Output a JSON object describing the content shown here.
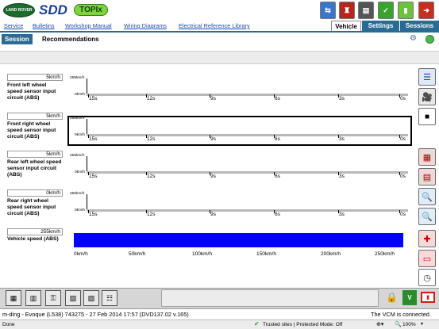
{
  "header": {
    "logo_land_rover": "LAND ROVER",
    "logo_sdd": "SDD",
    "logo_topix": "TOPIx"
  },
  "menu": {
    "links": [
      "Service",
      "Bulletins",
      "Workshop Manual",
      "Wiring Diagrams",
      "Electrical Reference Library"
    ],
    "tabs": [
      "Vehicle",
      "Settings",
      "Sessions"
    ]
  },
  "subtabs": [
    "Session",
    "Recommendations"
  ],
  "signals": [
    {
      "name": "Front left wheel speed sensor input circuit (ABS)",
      "value": "5km/h",
      "y_max": "255km/h",
      "y_min": "0km/h",
      "selected": false
    },
    {
      "name": "Front right wheel speed sensor input circuit (ABS)",
      "value": "5km/h",
      "y_max": "255km/h",
      "y_min": "0km/h",
      "selected": true
    },
    {
      "name": "Rear left wheel speed sensor input circuit (ABS)",
      "value": "5km/h",
      "y_max": "255km/h",
      "y_min": "0km/h",
      "selected": false
    },
    {
      "name": "Rear right wheel speed sensor input circuit (ABS)",
      "value": "0km/h",
      "y_max": "255km/h",
      "y_min": "0km/h",
      "selected": false
    }
  ],
  "time_ticks": [
    "15s",
    "12s",
    "9s",
    "6s",
    "3s",
    "0s"
  ],
  "vehicle_speed": {
    "name": "Vehicle speed (ABS)",
    "value": "255km/h",
    "fraction": 1.0,
    "ticks": [
      "0km/h",
      "50km/h",
      "100km/h",
      "150km/h",
      "200km/h",
      "250km/h"
    ],
    "bar_color": "#0000ff"
  },
  "status": {
    "vehicle_info": "m-ding - Evoque (L538) 743275 - 27 Feb 2014 17:57 (DVD137.02 v.165)",
    "connection": "The VCM is connected.",
    "browser_left": "Done",
    "browser_zone": "Trusted sites | Protected Mode: Off",
    "zoom": "100%"
  },
  "colors": {
    "accent_blue": "#1a4aa8",
    "tab_active_bg": "#2a6b94",
    "selection_border": "#000000"
  },
  "icons": {
    "top_right": [
      "vehicle-network-icon",
      "car-person-icon",
      "tools-drawer-icon",
      "checklist-icon",
      "battery-icon",
      "exit-door-icon"
    ],
    "right_toolbar": [
      "list-icon",
      "camera-icon",
      "stop-icon",
      "keypad-icon",
      "memory-icon",
      "zoom-in-icon",
      "zoom-out-icon",
      "add-trace-icon",
      "vehicle-icon",
      "time-icon"
    ],
    "bottom_toolbar": [
      "network-config-icon",
      "ecu-icon",
      "key-icon",
      "readout-icon",
      "scope-icon",
      "people-icon"
    ],
    "bottom_right": [
      "padlock-icon",
      "vci-icon",
      "battery-status-icon"
    ]
  }
}
